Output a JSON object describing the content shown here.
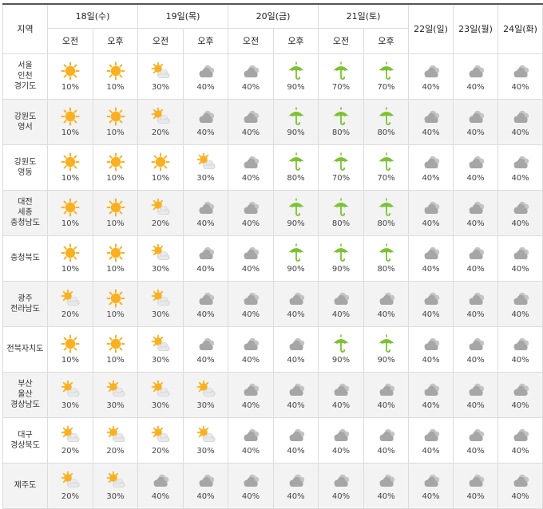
{
  "table": {
    "region_header": "지역",
    "am_label": "오전",
    "pm_label": "오후",
    "split_days": [
      "18일(수)",
      "19일(목)",
      "20일(금)",
      "21일(토)"
    ],
    "single_days": [
      "22일(일)",
      "23일(월)",
      "24일(화)"
    ],
    "rows": [
      {
        "region": [
          "서울",
          "인천",
          "경기도"
        ],
        "cells": [
          [
            "sunny",
            "10%"
          ],
          [
            "sunny",
            "10%"
          ],
          [
            "partly-cloudy",
            "30%"
          ],
          [
            "cloudy",
            "40%"
          ],
          [
            "cloudy",
            "40%"
          ],
          [
            "rain",
            "90%"
          ],
          [
            "rain",
            "70%"
          ],
          [
            "rain",
            "70%"
          ],
          [
            "cloudy",
            "40%"
          ],
          [
            "cloudy",
            "40%"
          ],
          [
            "cloudy",
            "40%"
          ]
        ]
      },
      {
        "region": [
          "강원도",
          "영서"
        ],
        "cells": [
          [
            "sunny",
            "10%"
          ],
          [
            "sunny",
            "10%"
          ],
          [
            "partly-cloudy",
            "20%"
          ],
          [
            "cloudy",
            "40%"
          ],
          [
            "cloudy",
            "40%"
          ],
          [
            "rain",
            "90%"
          ],
          [
            "rain",
            "80%"
          ],
          [
            "rain",
            "80%"
          ],
          [
            "cloudy",
            "40%"
          ],
          [
            "cloudy",
            "40%"
          ],
          [
            "cloudy",
            "40%"
          ]
        ]
      },
      {
        "region": [
          "강원도",
          "영동"
        ],
        "cells": [
          [
            "sunny",
            "10%"
          ],
          [
            "sunny",
            "10%"
          ],
          [
            "sunny",
            "10%"
          ],
          [
            "partly-cloudy",
            "30%"
          ],
          [
            "cloudy",
            "40%"
          ],
          [
            "rain",
            "80%"
          ],
          [
            "rain",
            "70%"
          ],
          [
            "rain",
            "70%"
          ],
          [
            "cloudy",
            "40%"
          ],
          [
            "cloudy",
            "40%"
          ],
          [
            "cloudy",
            "40%"
          ]
        ]
      },
      {
        "region": [
          "대전",
          "세종",
          "충청남도"
        ],
        "cells": [
          [
            "sunny",
            "10%"
          ],
          [
            "sunny",
            "10%"
          ],
          [
            "partly-cloudy",
            "20%"
          ],
          [
            "cloudy",
            "40%"
          ],
          [
            "cloudy",
            "40%"
          ],
          [
            "rain",
            "90%"
          ],
          [
            "rain",
            "80%"
          ],
          [
            "rain",
            "80%"
          ],
          [
            "cloudy",
            "40%"
          ],
          [
            "cloudy",
            "40%"
          ],
          [
            "cloudy",
            "40%"
          ]
        ]
      },
      {
        "region": [
          "충청북도"
        ],
        "cells": [
          [
            "sunny",
            "10%"
          ],
          [
            "sunny",
            "10%"
          ],
          [
            "partly-cloudy",
            "30%"
          ],
          [
            "cloudy",
            "40%"
          ],
          [
            "cloudy",
            "40%"
          ],
          [
            "rain",
            "90%"
          ],
          [
            "rain",
            "90%"
          ],
          [
            "rain",
            "80%"
          ],
          [
            "cloudy",
            "40%"
          ],
          [
            "cloudy",
            "40%"
          ],
          [
            "cloudy",
            "40%"
          ]
        ]
      },
      {
        "region": [
          "광주",
          "전라남도"
        ],
        "cells": [
          [
            "partly-cloudy",
            "20%"
          ],
          [
            "sunny",
            "10%"
          ],
          [
            "partly-cloudy",
            "30%"
          ],
          [
            "cloudy",
            "40%"
          ],
          [
            "cloudy",
            "40%"
          ],
          [
            "cloudy",
            "40%"
          ],
          [
            "cloudy",
            "40%"
          ],
          [
            "cloudy",
            "40%"
          ],
          [
            "cloudy",
            "40%"
          ],
          [
            "cloudy",
            "40%"
          ],
          [
            "cloudy",
            "40%"
          ]
        ]
      },
      {
        "region": [
          "전북자치도"
        ],
        "cells": [
          [
            "sunny",
            "10%"
          ],
          [
            "sunny",
            "10%"
          ],
          [
            "partly-cloudy",
            "30%"
          ],
          [
            "cloudy",
            "40%"
          ],
          [
            "cloudy",
            "40%"
          ],
          [
            "cloudy",
            "40%"
          ],
          [
            "rain",
            "90%"
          ],
          [
            "rain",
            "90%"
          ],
          [
            "cloudy",
            "40%"
          ],
          [
            "cloudy",
            "40%"
          ],
          [
            "cloudy",
            "40%"
          ]
        ]
      },
      {
        "region": [
          "부산",
          "울산",
          "경상남도"
        ],
        "cells": [
          [
            "partly-cloudy",
            "30%"
          ],
          [
            "partly-cloudy",
            "30%"
          ],
          [
            "partly-cloudy",
            "30%"
          ],
          [
            "partly-cloudy",
            "30%"
          ],
          [
            "cloudy",
            "40%"
          ],
          [
            "cloudy",
            "40%"
          ],
          [
            "cloudy",
            "40%"
          ],
          [
            "cloudy",
            "40%"
          ],
          [
            "cloudy",
            "40%"
          ],
          [
            "cloudy",
            "40%"
          ],
          [
            "cloudy",
            "40%"
          ]
        ]
      },
      {
        "region": [
          "대구",
          "경상북도"
        ],
        "cells": [
          [
            "partly-cloudy",
            "20%"
          ],
          [
            "partly-cloudy",
            "20%"
          ],
          [
            "partly-cloudy",
            "20%"
          ],
          [
            "partly-cloudy",
            "30%"
          ],
          [
            "cloudy",
            "40%"
          ],
          [
            "cloudy",
            "40%"
          ],
          [
            "cloudy",
            "40%"
          ],
          [
            "cloudy",
            "40%"
          ],
          [
            "cloudy",
            "40%"
          ],
          [
            "cloudy",
            "40%"
          ],
          [
            "cloudy",
            "40%"
          ]
        ]
      },
      {
        "region": [
          "제주도"
        ],
        "cells": [
          [
            "partly-cloudy",
            "20%"
          ],
          [
            "partly-cloudy",
            "30%"
          ],
          [
            "cloudy",
            "40%"
          ],
          [
            "cloudy",
            "40%"
          ],
          [
            "cloudy",
            "40%"
          ],
          [
            "cloudy",
            "40%"
          ],
          [
            "cloudy",
            "40%"
          ],
          [
            "cloudy",
            "40%"
          ],
          [
            "cloudy",
            "40%"
          ],
          [
            "cloudy",
            "40%"
          ],
          [
            "cloudy",
            "40%"
          ]
        ]
      }
    ]
  },
  "colors": {
    "sun": "#fbb021",
    "cloud": "#a6a6a6",
    "umbrella": "#7cc232",
    "border_top": "#555555",
    "row_alt": "#f3f3f3"
  }
}
